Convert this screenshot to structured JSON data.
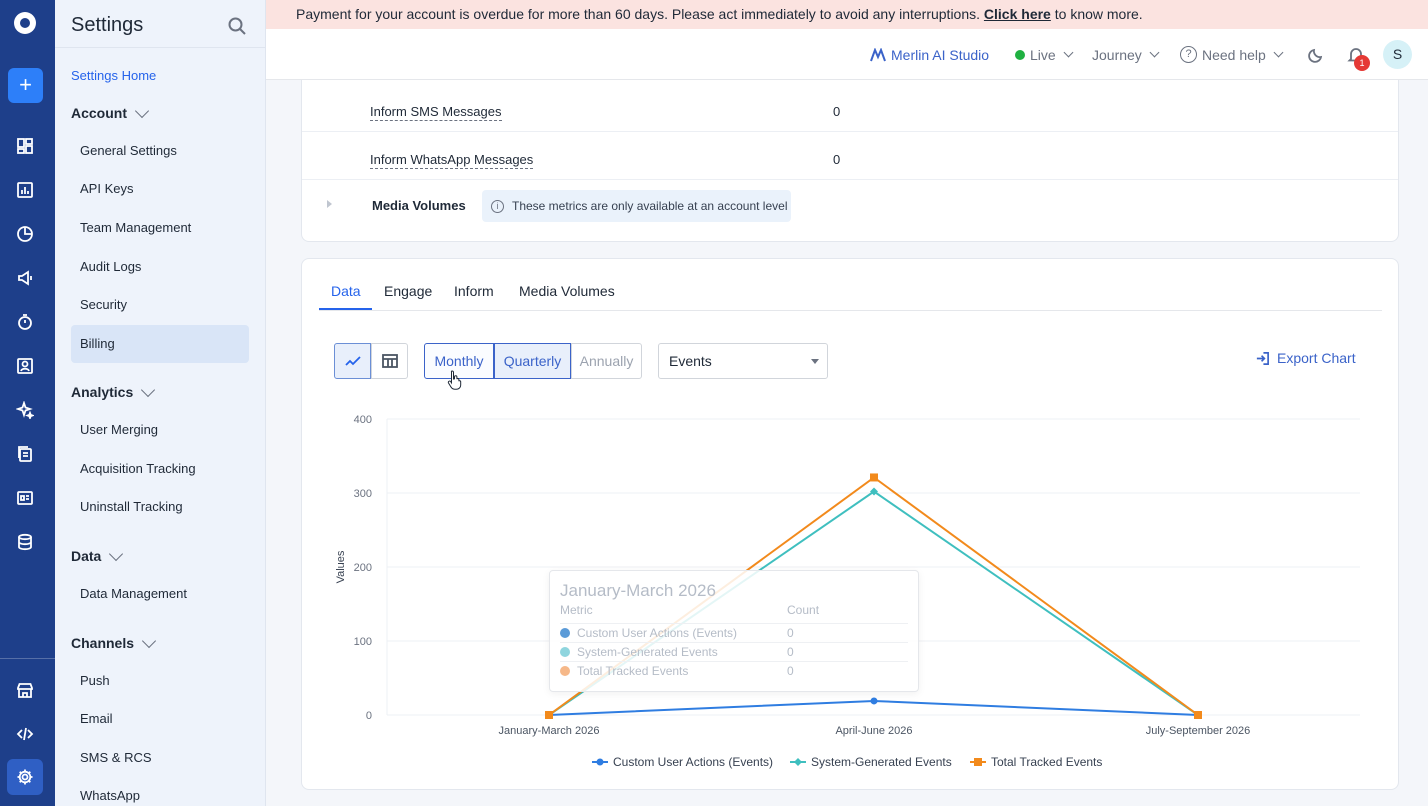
{
  "banner": {
    "text": "Payment for your account is overdue for more than 60 days. Please act immediately to avoid any interruptions.",
    "link": "Click here",
    "suffix": "to know more."
  },
  "header": {
    "merlin": "Merlin AI Studio",
    "live": "Live",
    "journey": "Journey",
    "help": "Need help",
    "notifications": "1",
    "avatar": "S"
  },
  "sidebar": {
    "title": "Settings",
    "home": "Settings Home",
    "groups": [
      {
        "label": "Account",
        "items": [
          "General Settings",
          "API Keys",
          "Team Management",
          "Audit Logs",
          "Security",
          "Billing"
        ]
      },
      {
        "label": "Analytics",
        "items": [
          "User Merging",
          "Acquisition Tracking",
          "Uninstall Tracking"
        ]
      },
      {
        "label": "Data",
        "items": [
          "Data Management"
        ]
      },
      {
        "label": "Channels",
        "items": [
          "Push",
          "Email",
          "SMS & RCS",
          "WhatsApp"
        ]
      }
    ],
    "active_item": "Billing"
  },
  "metrics": {
    "rows": [
      {
        "label": "Inform SMS Messages",
        "value": "0"
      },
      {
        "label": "Inform WhatsApp Messages",
        "value": "0"
      }
    ],
    "media_label": "Media Volumes",
    "media_note": "These metrics are only available at an account level"
  },
  "chart_panel": {
    "tabs": [
      "Data",
      "Engage",
      "Inform",
      "Media Volumes"
    ],
    "periods": [
      "Monthly",
      "Quarterly",
      "Annually"
    ],
    "metric_select": "Events",
    "export": "Export Chart"
  },
  "tooltip": {
    "title": "January-March 2026",
    "col_metric": "Metric",
    "col_count": "Count",
    "rows": [
      {
        "name": "Custom User Actions (Events)",
        "count": "0",
        "color": "#5b9bd8"
      },
      {
        "name": "System-Generated Events",
        "count": "0",
        "color": "#8fd5de"
      },
      {
        "name": "Total Tracked Events",
        "count": "0",
        "color": "#f6b889"
      }
    ]
  },
  "chart_data": {
    "type": "line",
    "categories": [
      "January-March 2026",
      "April-June 2026",
      "July-September 2026"
    ],
    "ylabel": "Values",
    "ylim": [
      0,
      400
    ],
    "yticks": [
      0,
      100,
      200,
      300,
      400
    ],
    "grid": true,
    "legend": "bottom",
    "series": [
      {
        "name": "Custom User Actions (Events)",
        "values": [
          0,
          19,
          0
        ],
        "color": "#2f7de1",
        "marker": "circle"
      },
      {
        "name": "System-Generated Events",
        "values": [
          0,
          302,
          0
        ],
        "color": "#3fbfbf",
        "marker": "diamond"
      },
      {
        "name": "Total Tracked Events",
        "values": [
          0,
          321,
          0
        ],
        "color": "#f28a1c",
        "marker": "square"
      }
    ]
  }
}
